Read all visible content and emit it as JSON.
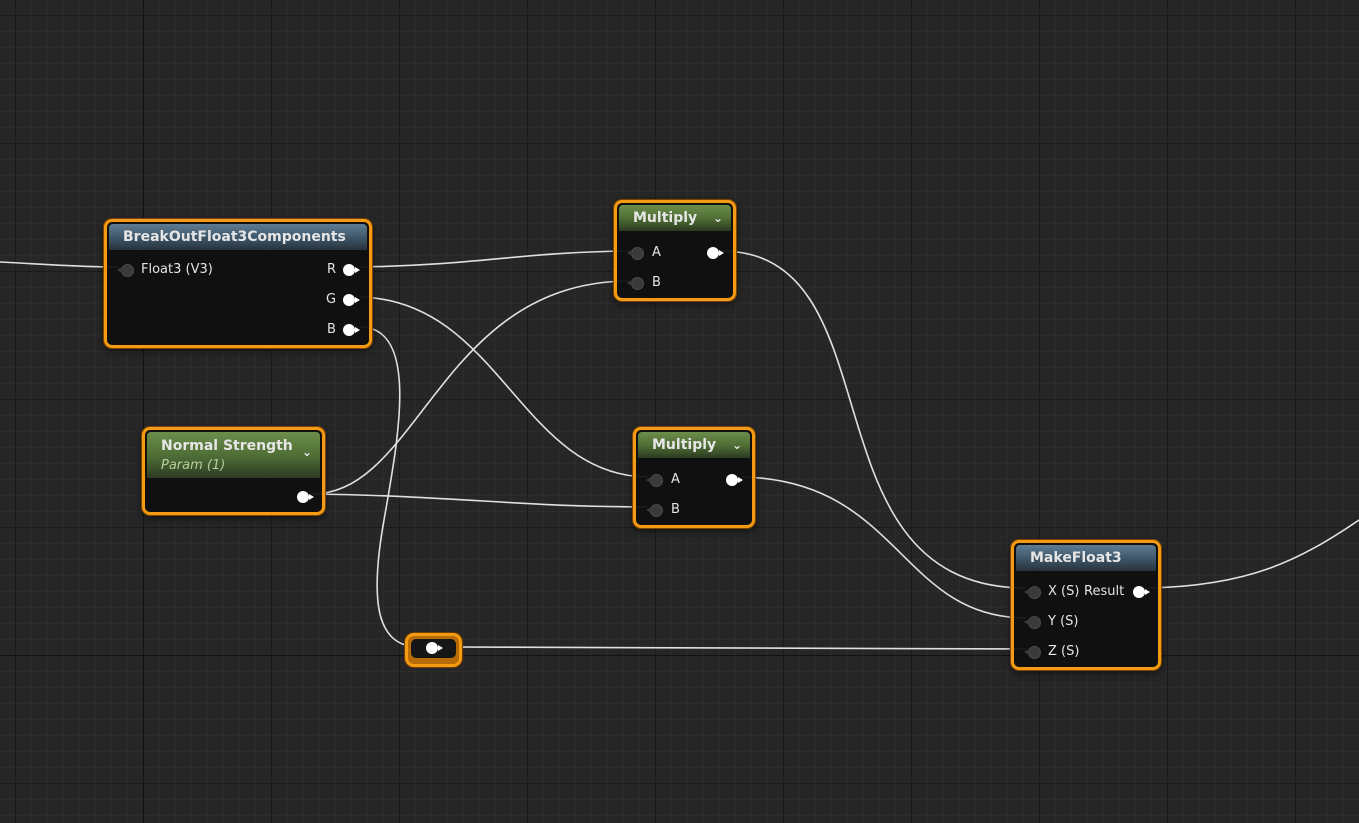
{
  "canvas": {
    "background": "#262626",
    "wire_color": "#e0e0e0",
    "selection_color": "#f59a13"
  },
  "nodes": {
    "break_out": {
      "title": "BreakOutFloat3Components",
      "header_color": "blue",
      "input": "Float3 (V3)",
      "outputs": [
        "R",
        "G",
        "B"
      ]
    },
    "multiply_top": {
      "title": "Multiply",
      "header_color": "green",
      "inputs": [
        "A",
        "B"
      ]
    },
    "normal_strength": {
      "title": "Normal Strength",
      "subtitle": "Param (1)",
      "header_color": "green"
    },
    "multiply_mid": {
      "title": "Multiply",
      "header_color": "green",
      "inputs": [
        "A",
        "B"
      ]
    },
    "make_float3": {
      "title": "MakeFloat3",
      "header_color": "blue",
      "inputs": [
        "X (S)",
        "Y (S)",
        "Z (S)"
      ],
      "output": "Result"
    }
  },
  "icons": {
    "expand": "chevron-down-icon",
    "reroute": "reroute-node"
  }
}
